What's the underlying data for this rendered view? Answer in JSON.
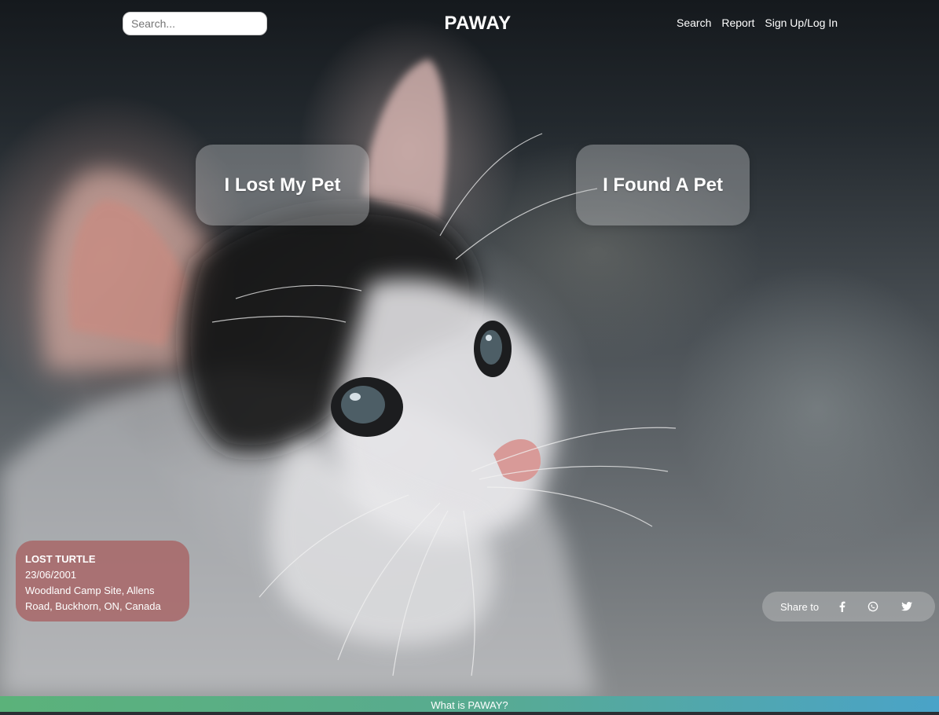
{
  "header": {
    "search_placeholder": "Search...",
    "brand": "PAWAY",
    "nav": {
      "search": "Search",
      "report": "Report",
      "signup": "Sign Up/Log In"
    }
  },
  "hero": {
    "background_image": "kitten-photo",
    "lost_button": "I Lost My Pet",
    "found_button": "I Found A Pet"
  },
  "alert": {
    "title": "LOST TURTLE",
    "date": "23/06/2001",
    "address_line1": "Woodland Camp Site, Allens",
    "address_line2": "Road, Buckhorn, ON, Canada"
  },
  "share": {
    "label": "Share to",
    "icons": [
      "facebook-icon",
      "whatsapp-icon",
      "twitter-icon"
    ]
  },
  "footer": {
    "label": "What is PAWAY?"
  },
  "colors": {
    "alert_bg": "#a86062",
    "footer_gradient_start": "#5bb27a",
    "footer_gradient_end": "#4aa3c8"
  }
}
